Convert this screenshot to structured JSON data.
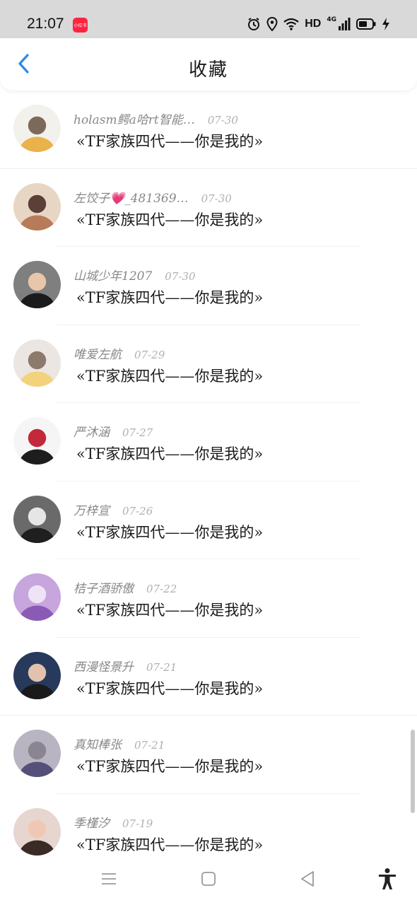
{
  "status_bar": {
    "time": "21:07",
    "app_badge": "小红书",
    "network_label": "HD",
    "network_type": "4G",
    "icons": [
      "alarm-icon",
      "location-icon",
      "wifi-icon",
      "signal-icon",
      "battery-icon",
      "charging-icon"
    ]
  },
  "header": {
    "title": "收藏",
    "back_icon": "chevron-left-icon",
    "accent_color": "#2a8ae8"
  },
  "favorites": [
    {
      "author": "holasm鳄a哈rt智能…",
      "date": "07-30",
      "title": "«TF家族四代——你是我的»",
      "avatar_colors": [
        "#f3f1ec",
        "#e9b24a",
        "#7b6a5a"
      ]
    },
    {
      "author": "左饺子💗_481369…",
      "date": "07-30",
      "title": "«TF家族四代——你是我的»",
      "avatar_colors": [
        "#e8d6c4",
        "#b77b5a",
        "#5a4036"
      ]
    },
    {
      "author": "山城少年1207",
      "date": "07-30",
      "title": "«TF家族四代——你是我的»",
      "avatar_colors": [
        "#7f7f7f",
        "#1b1b1b",
        "#e8c6aa"
      ]
    },
    {
      "author": "唯爱左航",
      "date": "07-29",
      "title": "«TF家族四代——你是我的»",
      "avatar_colors": [
        "#ebe6e2",
        "#f2d27a",
        "#8c7a6a"
      ]
    },
    {
      "author": "严沐涵",
      "date": "07-27",
      "title": "«TF家族四代——你是我的»",
      "avatar_colors": [
        "#f5f5f5",
        "#1d1d1d",
        "#c4283b"
      ]
    },
    {
      "author": "万梓宣",
      "date": "07-26",
      "title": "«TF家族四代——你是我的»",
      "avatar_colors": [
        "#6a6a6a",
        "#1f1f1f",
        "#e6e6e6"
      ]
    },
    {
      "author": "桔子酒骄傲",
      "date": "07-22",
      "title": "«TF家族四代——你是我的»",
      "avatar_colors": [
        "#c7a5dd",
        "#8a5bb5",
        "#efe3f6"
      ]
    },
    {
      "author": "西漫怪景升",
      "date": "07-21",
      "title": "«TF家族四代——你是我的»",
      "avatar_colors": [
        "#273a5c",
        "#1a1a1a",
        "#e2c2ad"
      ]
    },
    {
      "author": "真知棒张",
      "date": "07-21",
      "title": "«TF家族四代——你是我的»",
      "avatar_colors": [
        "#b9b4c2",
        "#55507a",
        "#8a8590"
      ]
    },
    {
      "author": "季槿汐",
      "date": "07-19",
      "title": "«TF家族四代——你是我的»",
      "avatar_colors": [
        "#e7d6cf",
        "#3b2b26",
        "#f0c7b4"
      ]
    }
  ],
  "nav": {
    "items": [
      "menu-icon",
      "home-icon",
      "back-triangle-icon",
      "accessibility-icon"
    ]
  }
}
